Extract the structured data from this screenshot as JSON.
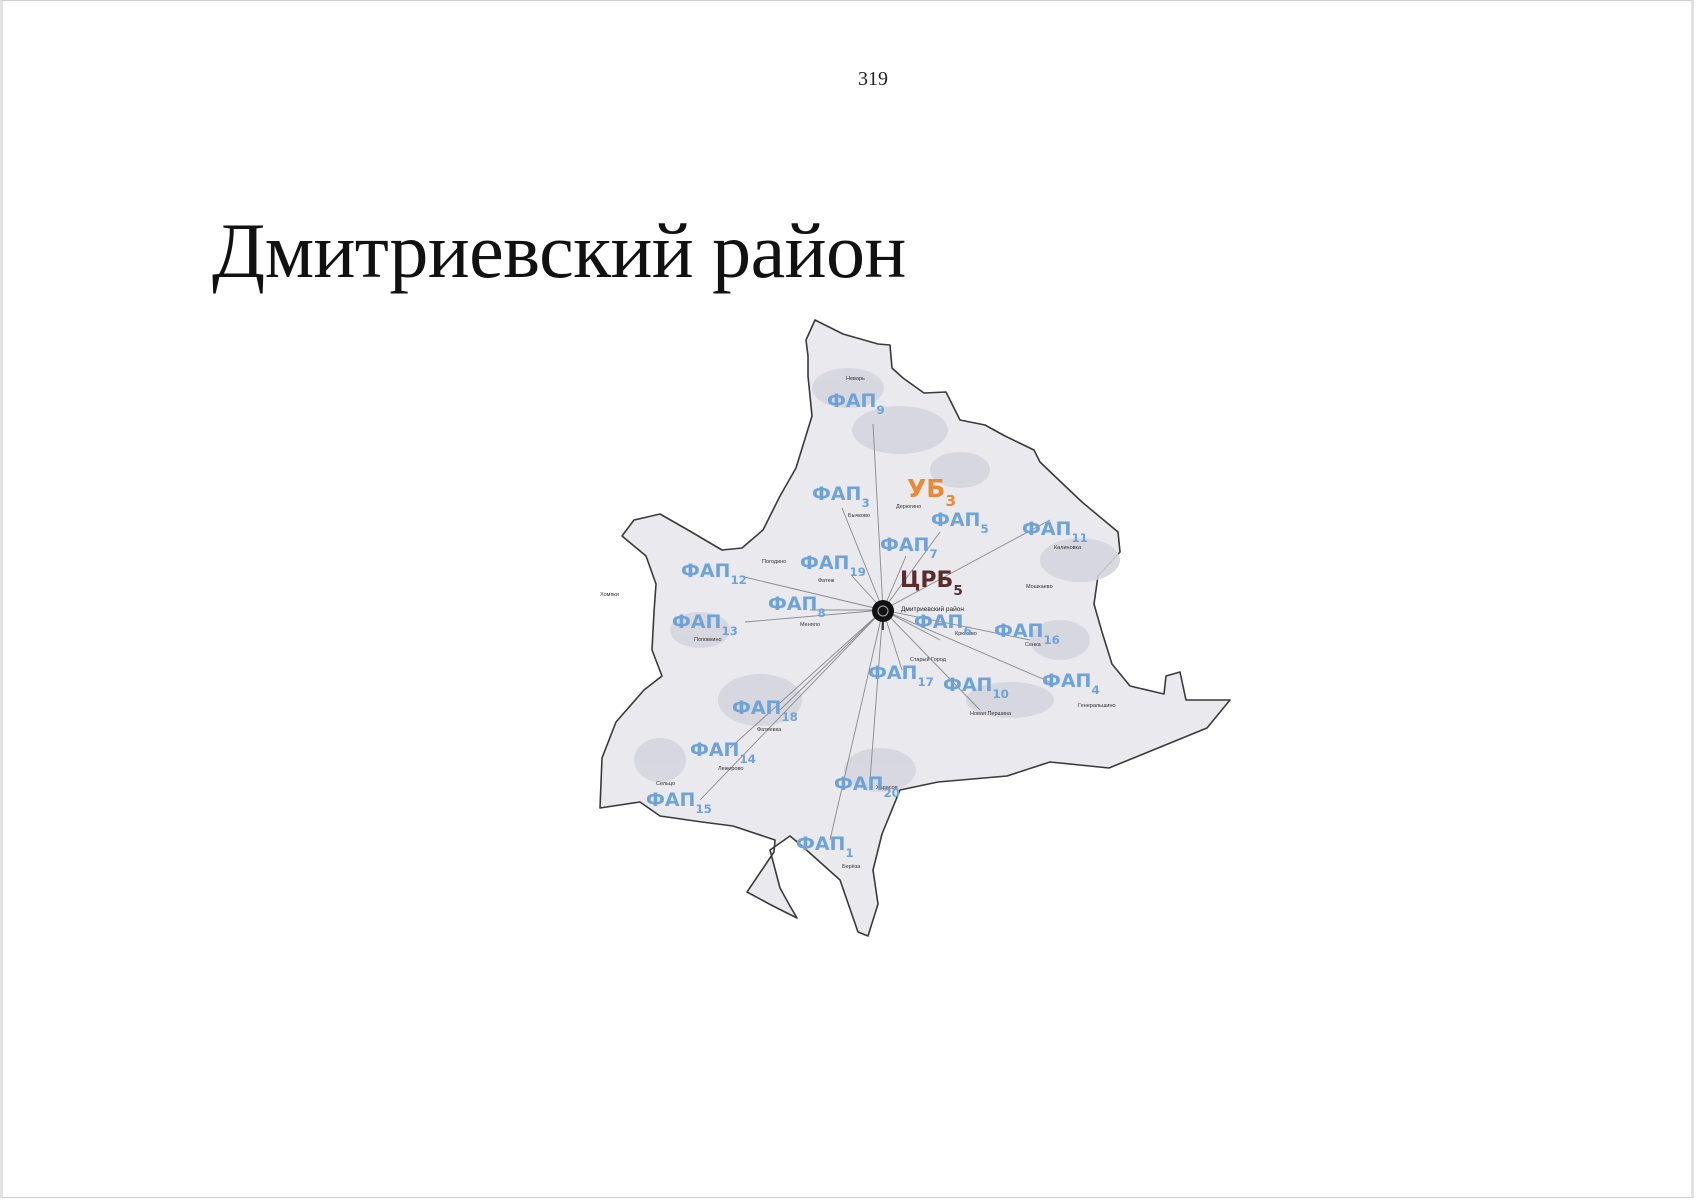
{
  "page_number": "319",
  "title": "Дмитриевский район",
  "map": {
    "district_label": "Дмитриевский район",
    "ub": {
      "base": "УБ",
      "sub": "3"
    },
    "crb": {
      "base": "ЦРБ",
      "sub": "5"
    },
    "faps": [
      {
        "id": "fap-9",
        "base": "ФАП",
        "sub": "9"
      },
      {
        "id": "fap-3",
        "base": "ФАП",
        "sub": "3"
      },
      {
        "id": "fap-5",
        "base": "ФАП",
        "sub": "5"
      },
      {
        "id": "fap-11",
        "base": "ФАП",
        "sub": "11"
      },
      {
        "id": "fap-7",
        "base": "ФАП",
        "sub": "7"
      },
      {
        "id": "fap-19",
        "base": "ФАП",
        "sub": "19"
      },
      {
        "id": "fap-12",
        "base": "ФАП",
        "sub": "12"
      },
      {
        "id": "fap-8",
        "base": "ФАП",
        "sub": "8"
      },
      {
        "id": "fap-13",
        "base": "ФАП",
        "sub": "13"
      },
      {
        "id": "fap-6",
        "base": "ФАП",
        "sub": "6"
      },
      {
        "id": "fap-16",
        "base": "ФАП",
        "sub": "16"
      },
      {
        "id": "fap-17",
        "base": "ФАП",
        "sub": "17"
      },
      {
        "id": "fap-10",
        "base": "ФАП",
        "sub": "10"
      },
      {
        "id": "fap-4",
        "base": "ФАП",
        "sub": "4"
      },
      {
        "id": "fap-18",
        "base": "ФАП",
        "sub": "18"
      },
      {
        "id": "fap-14",
        "base": "ФАП",
        "sub": "14"
      },
      {
        "id": "fap-20",
        "base": "ФАП",
        "sub": "20"
      },
      {
        "id": "fap-15",
        "base": "ФАП",
        "sub": "15"
      },
      {
        "id": "fap-1",
        "base": "ФАП",
        "sub": "1"
      }
    ],
    "colors": {
      "fap": "#6fa3d8",
      "ub": "#e98a3a",
      "crb": "#5b2a2a",
      "land": "#e9e9ee",
      "border": "#3a3a3a"
    }
  }
}
